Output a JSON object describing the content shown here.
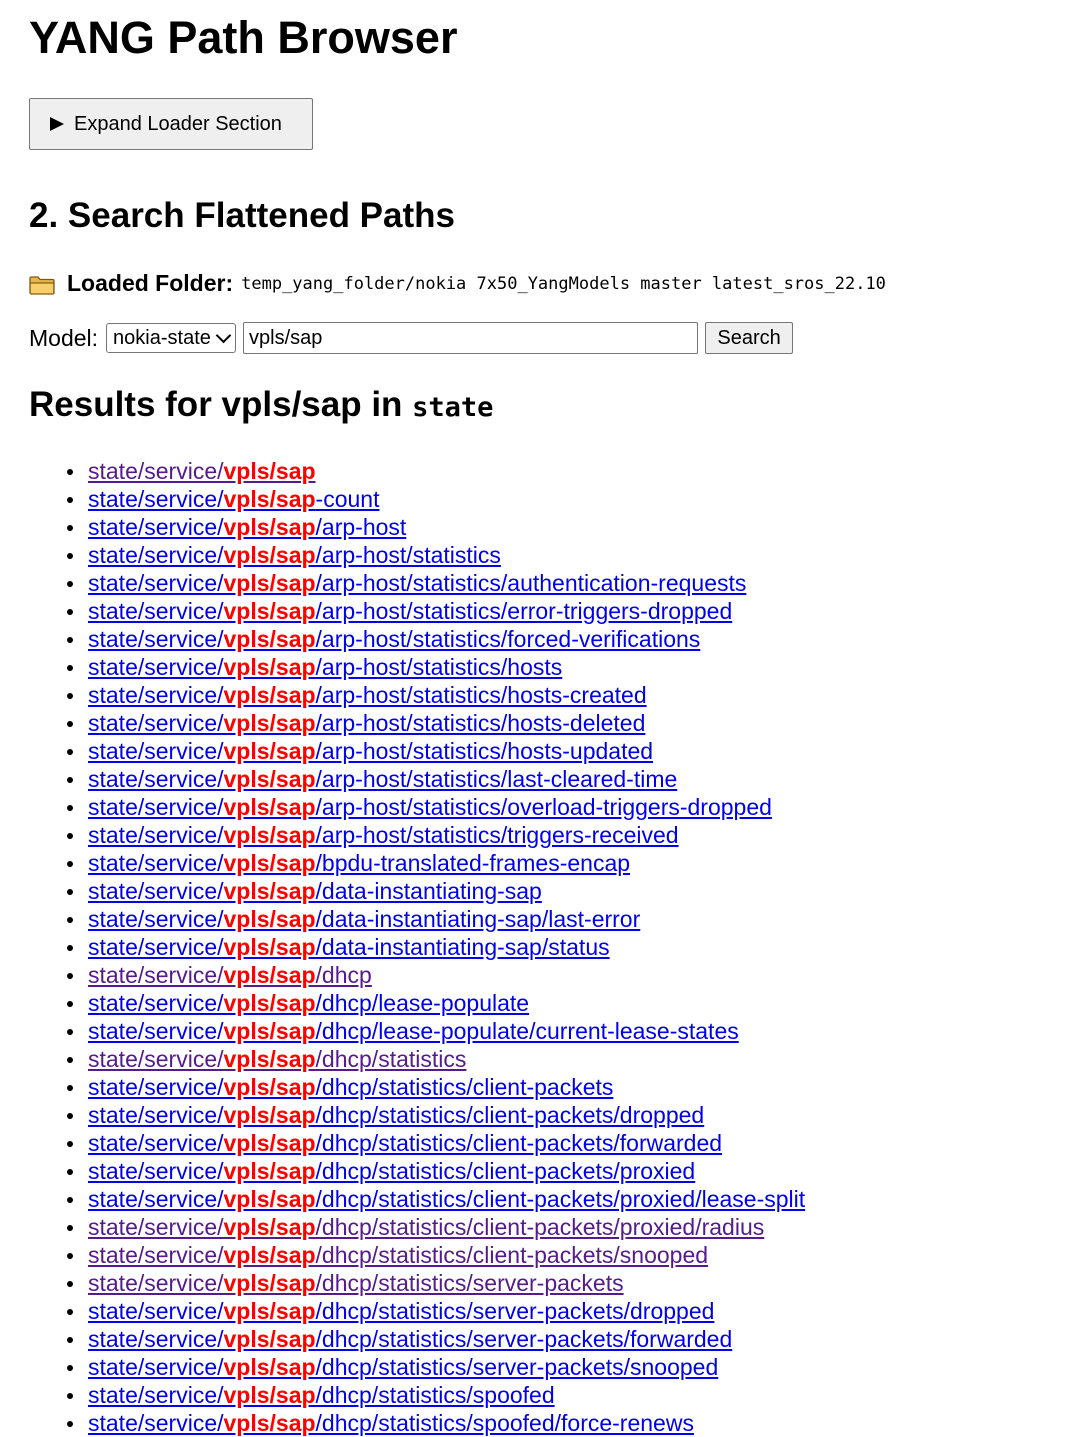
{
  "page": {
    "title": "YANG Path Browser",
    "expand_button_label": "Expand Loader Section",
    "section_title": "2. Search Flattened Paths",
    "loaded_label": "Loaded Folder:",
    "loaded_path": "temp_yang_folder/nokia 7x50_YangModels master latest_sros_22.10",
    "model_label": "Model:",
    "model_selected": "nokia-state",
    "search_value": "vpls/sap",
    "search_button_label": "Search",
    "results_prefix": "Results for vpls/sap in ",
    "results_model": "state"
  },
  "icons": {
    "folder": "folder-icon",
    "expand": "triangle-right-icon",
    "select": "chevron-down-icon"
  },
  "colors": {
    "link": "#0000ee",
    "visited_link": "#551a8b",
    "highlight": "#ff0000"
  },
  "results": {
    "prefix": "state/service/",
    "match": "vpls/sap",
    "items": [
      {
        "suffix": "",
        "visited": true
      },
      {
        "suffix": "-count",
        "visited": false
      },
      {
        "suffix": "/arp-host",
        "visited": false
      },
      {
        "suffix": "/arp-host/statistics",
        "visited": false
      },
      {
        "suffix": "/arp-host/statistics/authentication-requests",
        "visited": false
      },
      {
        "suffix": "/arp-host/statistics/error-triggers-dropped",
        "visited": false
      },
      {
        "suffix": "/arp-host/statistics/forced-verifications",
        "visited": false
      },
      {
        "suffix": "/arp-host/statistics/hosts",
        "visited": false
      },
      {
        "suffix": "/arp-host/statistics/hosts-created",
        "visited": false
      },
      {
        "suffix": "/arp-host/statistics/hosts-deleted",
        "visited": false
      },
      {
        "suffix": "/arp-host/statistics/hosts-updated",
        "visited": false
      },
      {
        "suffix": "/arp-host/statistics/last-cleared-time",
        "visited": false
      },
      {
        "suffix": "/arp-host/statistics/overload-triggers-dropped",
        "visited": false
      },
      {
        "suffix": "/arp-host/statistics/triggers-received",
        "visited": false
      },
      {
        "suffix": "/bpdu-translated-frames-encap",
        "visited": false
      },
      {
        "suffix": "/data-instantiating-sap",
        "visited": false
      },
      {
        "suffix": "/data-instantiating-sap/last-error",
        "visited": false
      },
      {
        "suffix": "/data-instantiating-sap/status",
        "visited": false
      },
      {
        "suffix": "/dhcp",
        "visited": true
      },
      {
        "suffix": "/dhcp/lease-populate",
        "visited": false
      },
      {
        "suffix": "/dhcp/lease-populate/current-lease-states",
        "visited": false
      },
      {
        "suffix": "/dhcp/statistics",
        "visited": true
      },
      {
        "suffix": "/dhcp/statistics/client-packets",
        "visited": false
      },
      {
        "suffix": "/dhcp/statistics/client-packets/dropped",
        "visited": false
      },
      {
        "suffix": "/dhcp/statistics/client-packets/forwarded",
        "visited": false
      },
      {
        "suffix": "/dhcp/statistics/client-packets/proxied",
        "visited": false
      },
      {
        "suffix": "/dhcp/statistics/client-packets/proxied/lease-split",
        "visited": false
      },
      {
        "suffix": "/dhcp/statistics/client-packets/proxied/radius",
        "visited": true
      },
      {
        "suffix": "/dhcp/statistics/client-packets/snooped",
        "visited": true
      },
      {
        "suffix": "/dhcp/statistics/server-packets",
        "visited": true
      },
      {
        "suffix": "/dhcp/statistics/server-packets/dropped",
        "visited": false
      },
      {
        "suffix": "/dhcp/statistics/server-packets/forwarded",
        "visited": false
      },
      {
        "suffix": "/dhcp/statistics/server-packets/snooped",
        "visited": false
      },
      {
        "suffix": "/dhcp/statistics/spoofed",
        "visited": false
      },
      {
        "suffix": "/dhcp/statistics/spoofed/force-renews",
        "visited": false
      }
    ]
  }
}
